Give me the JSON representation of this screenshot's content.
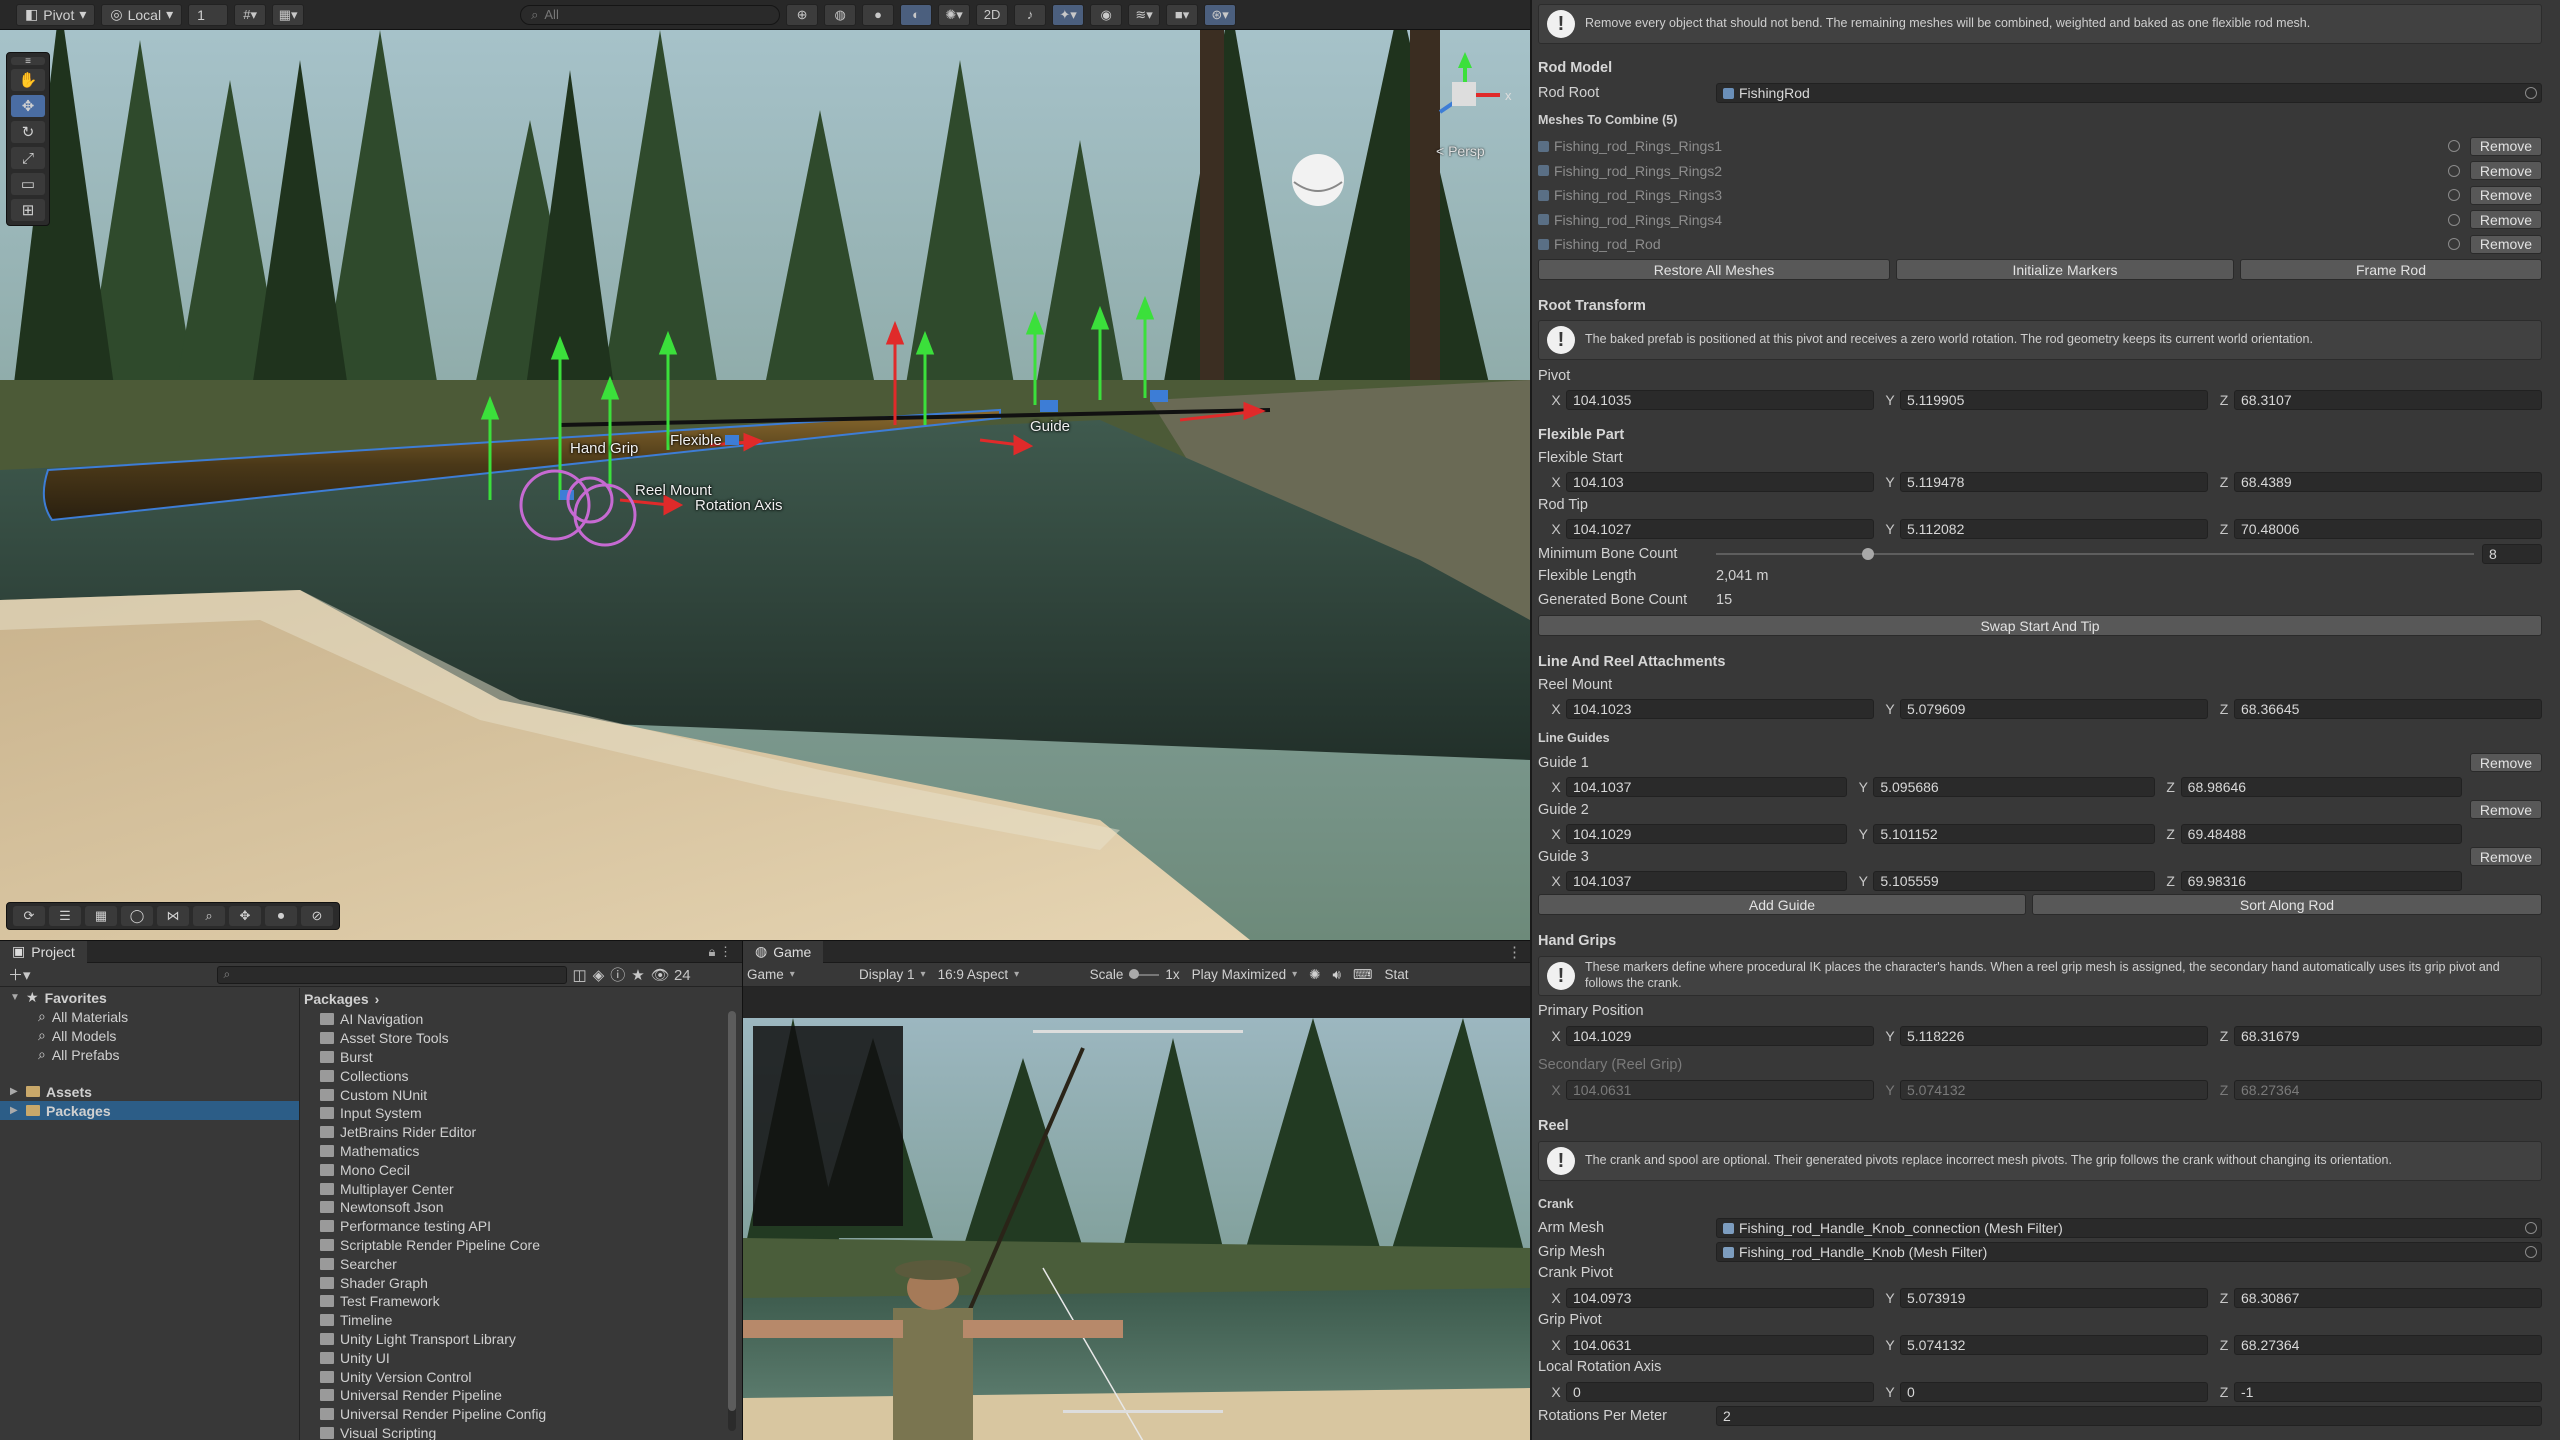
{
  "scene_toolbar": {
    "pivot": "Pivot",
    "local": "Local",
    "snap_value": "1",
    "search_placeholder": "All"
  },
  "scene": {
    "labels": {
      "handle_grip": "Hand Grip",
      "flexible": "Flexible",
      "guide": "Guide",
      "rotation_axis": "Rotation Axis",
      "reel_mount": "Reel Mount"
    },
    "persp": "< Persp"
  },
  "inspector": {
    "warning": "Remove every object that should not bend. The remaining meshes will be combined, weighted and baked as one flexible rod mesh.",
    "rod_model": {
      "header": "Rod Model",
      "rod_root_label": "Rod Root",
      "rod_root_value": "FishingRod",
      "meshes_header": "Meshes To Combine (5)",
      "meshes": [
        "Fishing_rod_Rings_Rings1",
        "Fishing_rod_Rings_Rings2",
        "Fishing_rod_Rings_Rings3",
        "Fishing_rod_Rings_Rings4",
        "Fishing_rod_Rod"
      ],
      "remove": "Remove",
      "restore": "Restore All Meshes",
      "init_markers": "Initialize Markers",
      "frame_rod": "Frame Rod"
    },
    "root_transform": {
      "header": "Root Transform",
      "info": "The baked prefab is positioned at this pivot and receives a zero world rotation. The rod geometry keeps its current world orientation.",
      "pivot_label": "Pivot",
      "pivot": [
        "104.1035",
        "5.119905",
        "68.3107"
      ]
    },
    "flexible_part": {
      "header": "Flexible Part",
      "start_label": "Flexible Start",
      "start": [
        "104.103",
        "5.119478",
        "68.4389"
      ],
      "tip_label": "Rod Tip",
      "tip": [
        "104.1027",
        "5.112082",
        "70.48006"
      ],
      "min_bone_label": "Minimum Bone Count",
      "min_bone_value": "8",
      "min_bone_fraction": 0.2,
      "length_label": "Flexible Length",
      "length_value": "2,041 m",
      "gen_bone_label": "Generated Bone Count",
      "gen_bone_value": "15",
      "swap": "Swap Start And Tip"
    },
    "line_reel": {
      "header": "Line And Reel Attachments",
      "reel_mount_label": "Reel Mount",
      "reel_mount": [
        "104.1023",
        "5.079609",
        "68.36645"
      ],
      "guides_header": "Line Guides",
      "guides": [
        {
          "label": "Guide 1",
          "xyz": [
            "104.1037",
            "5.095686",
            "68.98646"
          ]
        },
        {
          "label": "Guide 2",
          "xyz": [
            "104.1029",
            "5.101152",
            "69.48488"
          ]
        },
        {
          "label": "Guide 3",
          "xyz": [
            "104.1037",
            "5.105559",
            "69.98316"
          ]
        }
      ],
      "add_guide": "Add Guide",
      "sort": "Sort Along Rod"
    },
    "hand_grips": {
      "header": "Hand Grips",
      "info": "These markers define where procedural IK places the character's hands. When a reel grip mesh is assigned, the secondary hand automatically uses its grip pivot and follows the crank.",
      "primary_label": "Primary Position",
      "primary": [
        "104.1029",
        "5.118226",
        "68.31679"
      ],
      "secondary_label": "Secondary (Reel Grip)",
      "secondary": [
        "104.0631",
        "5.074132",
        "68.27364"
      ]
    },
    "reel": {
      "header": "Reel",
      "info": "The crank and spool are optional. Their generated pivots replace incorrect mesh pivots. The grip follows the crank without changing its orientation.",
      "crank_header": "Crank",
      "arm_mesh_label": "Arm Mesh",
      "arm_mesh_value": "Fishing_rod_Handle_Knob_connection (Mesh Filter)",
      "grip_mesh_label": "Grip Mesh",
      "grip_mesh_value": "Fishing_rod_Handle_Knob (Mesh Filter)",
      "crank_pivot_label": "Crank Pivot",
      "crank_pivot": [
        "104.0973",
        "5.073919",
        "68.30867"
      ],
      "grip_pivot_label": "Grip Pivot",
      "grip_pivot": [
        "104.0631",
        "5.074132",
        "68.27364"
      ],
      "rot_axis_label": "Local Rotation Axis",
      "rot_axis": [
        "0",
        "0",
        "-1"
      ],
      "rpm_label": "Rotations Per Meter",
      "rpm_value": "2"
    },
    "axes": [
      "X",
      "Y",
      "Z"
    ]
  },
  "project": {
    "tab": "Project",
    "count": "24",
    "favorites": "Favorites",
    "fav_items": [
      "All Materials",
      "All Models",
      "All Prefabs"
    ],
    "assets": "Assets",
    "packages": "Packages",
    "breadcrumb": "Packages",
    "package_list": [
      "AI Navigation",
      "Asset Store Tools",
      "Burst",
      "Collections",
      "Custom NUnit",
      "Input System",
      "JetBrains Rider Editor",
      "Mathematics",
      "Mono Cecil",
      "Multiplayer Center",
      "Newtonsoft Json",
      "Performance testing API",
      "Scriptable Render Pipeline Core",
      "Searcher",
      "Shader Graph",
      "Test Framework",
      "Timeline",
      "Unity Light Transport Library",
      "Unity UI",
      "Unity Version Control",
      "Universal Render Pipeline",
      "Universal Render Pipeline Config",
      "Visual Scripting"
    ]
  },
  "game": {
    "tab": "Game",
    "mode": "Game",
    "display": "Display 1",
    "aspect": "16:9 Aspect",
    "scale_label": "Scale",
    "scale_value": "1x",
    "play_mode": "Play Maximized",
    "stats": "Stat"
  }
}
